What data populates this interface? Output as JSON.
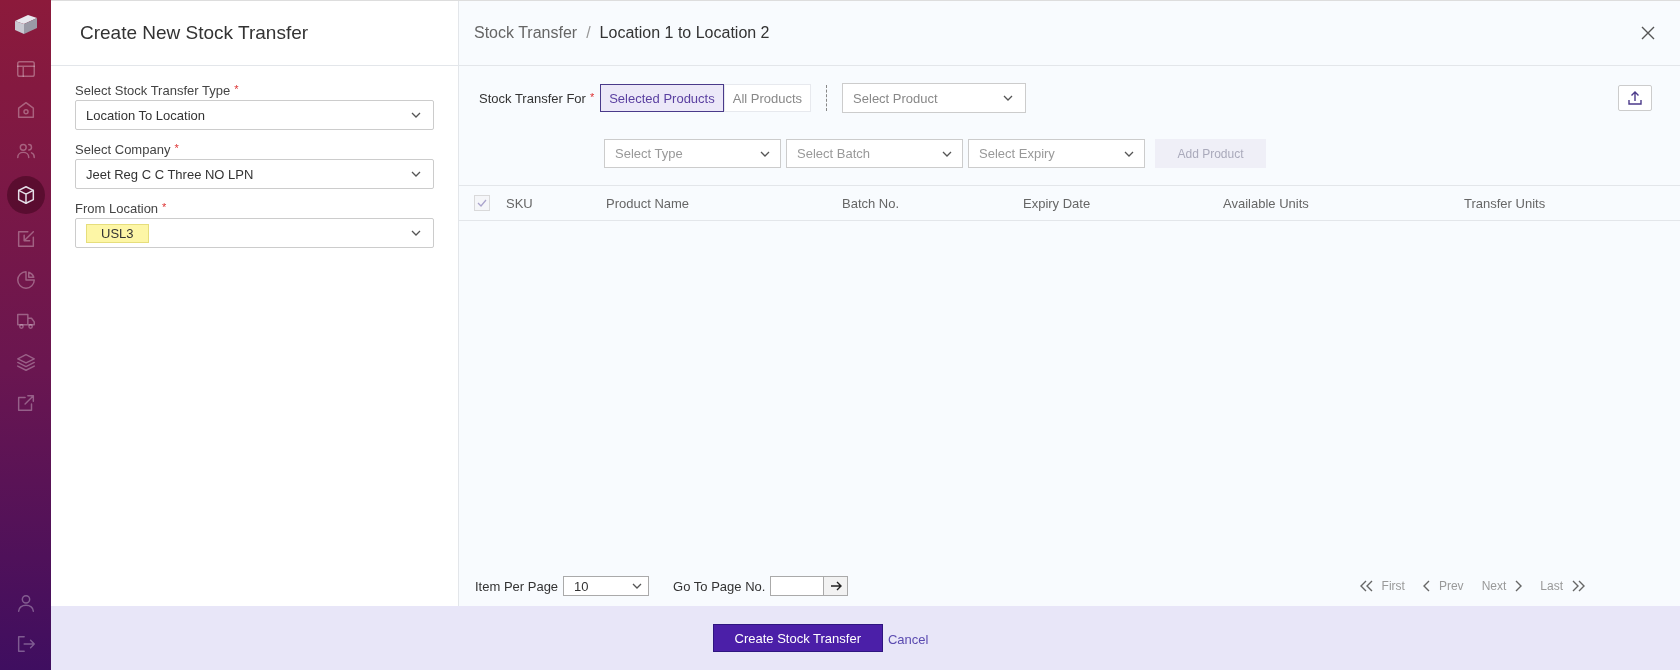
{
  "sidebar": {
    "items": [
      {
        "kind": "logo",
        "selected": false
      },
      {
        "kind": "layout",
        "selected": false
      },
      {
        "kind": "home",
        "selected": false
      },
      {
        "kind": "users",
        "selected": false
      },
      {
        "kind": "cube",
        "selected": true
      },
      {
        "kind": "inbound",
        "selected": false
      },
      {
        "kind": "pie",
        "selected": false
      },
      {
        "kind": "truck",
        "selected": false
      },
      {
        "kind": "layers",
        "selected": false
      },
      {
        "kind": "external",
        "selected": false
      }
    ],
    "bottom_items": [
      {
        "kind": "user",
        "selected": false
      },
      {
        "kind": "logout",
        "selected": false
      }
    ]
  },
  "form": {
    "title": "Create New Stock Transfer",
    "fields": [
      {
        "label": "Select Stock Transfer Type",
        "required_mark": "*",
        "value": "Location To Location",
        "highlighted": false
      },
      {
        "label": "Select Company",
        "required_mark": "*",
        "value": "Jeet Reg C C Three NO LPN",
        "highlighted": false
      },
      {
        "label": "From Location",
        "required_mark": "*",
        "value": "USL3",
        "highlighted": true
      }
    ]
  },
  "breadcrumb": {
    "parent": "Stock Transfer",
    "separator": "/",
    "current": "Location 1 to Location 2"
  },
  "transfer_for": {
    "label": "Stock Transfer For",
    "required_mark": "*",
    "options": [
      {
        "label": "Selected Products",
        "selected": true
      },
      {
        "label": "All Products",
        "selected": false
      }
    ]
  },
  "product_select": {
    "placeholder": "Select Product"
  },
  "filters": [
    {
      "placeholder": "Select Type"
    },
    {
      "placeholder": "Select Batch"
    },
    {
      "placeholder": "Select Expiry"
    }
  ],
  "add_product": {
    "label": "Add Product",
    "disabled": true
  },
  "table": {
    "select_all": {
      "checked": true,
      "disabled": true
    },
    "columns": [
      "SKU",
      "Product Name",
      "Batch No.",
      "Expiry Date",
      "Available Units",
      "Transfer Units"
    ]
  },
  "pagination": {
    "per_page_label": "Item Per Page",
    "per_page": "10",
    "goto_label": "Go To Page No.",
    "links": [
      {
        "kind": "first",
        "label": "First",
        "disabled": true
      },
      {
        "kind": "prev",
        "label": "Prev",
        "disabled": true
      },
      {
        "kind": "next",
        "label": "Next",
        "disabled": true
      },
      {
        "kind": "last",
        "label": "Last",
        "disabled": true
      }
    ]
  },
  "actions": {
    "primary": "Create Stock Transfer",
    "secondary": "Cancel"
  }
}
